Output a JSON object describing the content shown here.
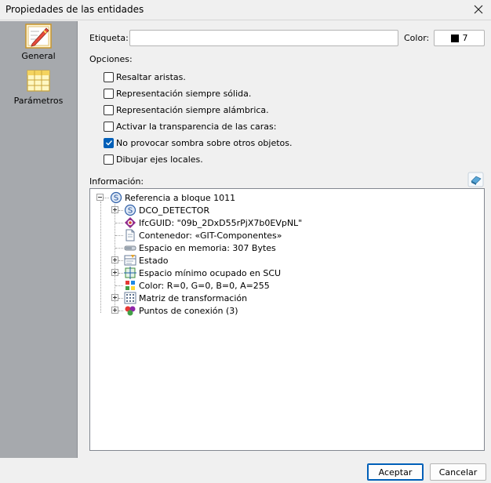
{
  "window": {
    "title": "Propiedades de las entidades"
  },
  "sidebar": {
    "items": [
      {
        "label": "General",
        "icon": "pencil-notepad-icon",
        "active": true
      },
      {
        "label": "Parámetros",
        "icon": "table-grid-icon",
        "active": false
      }
    ]
  },
  "form": {
    "label_caption": "Etiqueta:",
    "label_value": "",
    "color_caption": "Color:",
    "color_value": "7",
    "color_swatch": "#000000",
    "options_caption": "Opciones:",
    "options": [
      {
        "label": "Resaltar aristas.",
        "checked": false
      },
      {
        "label": "Representación siempre sólida.",
        "checked": false
      },
      {
        "label": "Representación siempre alámbrica.",
        "checked": false
      },
      {
        "label": "Activar la transparencia de las caras:",
        "checked": false
      },
      {
        "label": "No provocar sombra sobre otros objetos.",
        "checked": true
      },
      {
        "label": "Dibujar ejes locales.",
        "checked": false
      }
    ],
    "info_caption": "Información:"
  },
  "tree": {
    "root": "Referencia a bloque 1011",
    "children": [
      {
        "label": "DCO_DETECTOR",
        "icon": "s-circle-icon",
        "expandable": true
      },
      {
        "label": "IfcGUID: \"09b_2DxD55rPjX7b0EVpNL\"",
        "icon": "ifc-guid-icon",
        "expandable": false
      },
      {
        "label": "Contenedor: «GIT-Componentes»",
        "icon": "document-icon",
        "expandable": false
      },
      {
        "label": "Espacio en memoria: 307 Bytes",
        "icon": "memory-bar-icon",
        "expandable": false
      },
      {
        "label": "Estado",
        "icon": "state-list-icon",
        "expandable": true
      },
      {
        "label": "Espacio mínimo ocupado en SCU",
        "icon": "bounding-box-icon",
        "expandable": true
      },
      {
        "label": "Color: R=0, G=0, B=0, A=255",
        "icon": "color-palette-icon",
        "expandable": false
      },
      {
        "label": "Matriz de transformación",
        "icon": "matrix-icon",
        "expandable": true
      },
      {
        "label": "Puntos de conexión (3)",
        "icon": "connection-points-icon",
        "expandable": true
      }
    ]
  },
  "buttons": {
    "accept": "Aceptar",
    "cancel": "Cancelar"
  },
  "colors": {
    "accent": "#005fb8",
    "sidebar": "#a6a9ad"
  }
}
